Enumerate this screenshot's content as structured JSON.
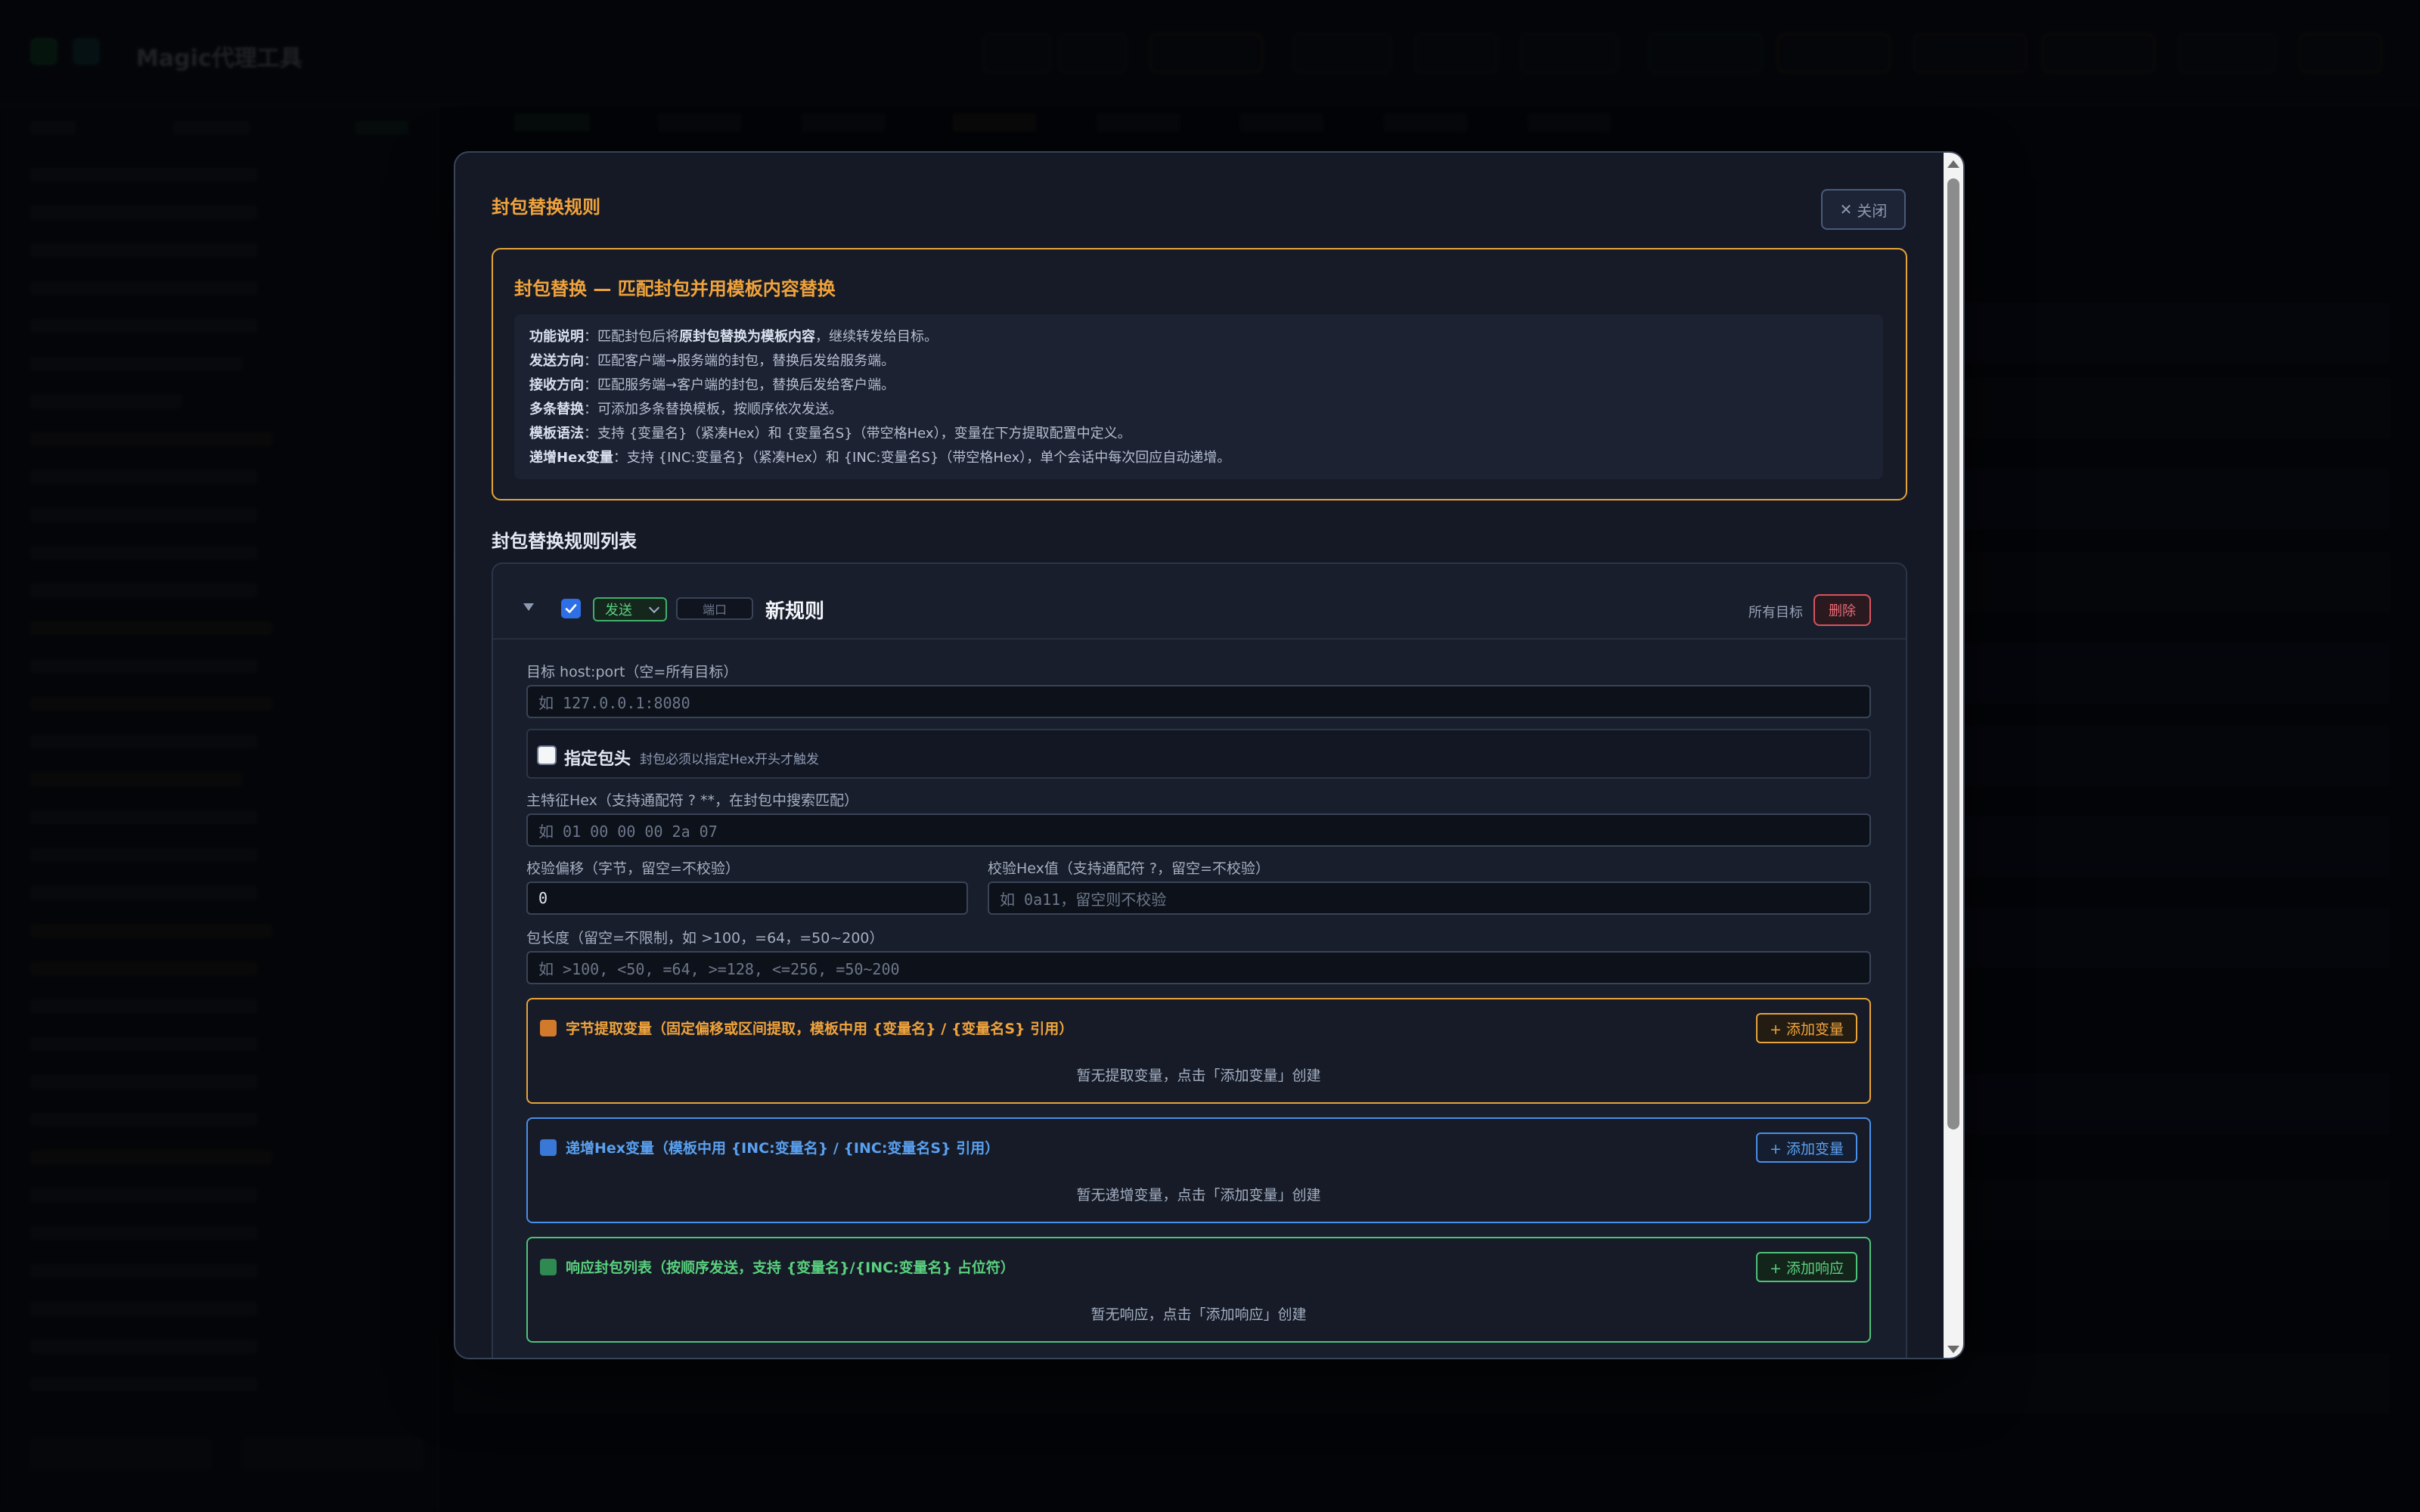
{
  "background_app": {
    "title": "Magic代理工具"
  },
  "modal": {
    "title": "封包替换规则",
    "close_label": "关闭",
    "info": {
      "heading": "封包替换 — 匹配封包并用模板内容替换",
      "lines": [
        {
          "key": "功能说明",
          "text": "：匹配封包后将",
          "bold": "原封包替换为模板内容",
          "tail": "，继续转发给目标。"
        },
        {
          "key": "发送方向",
          "text": "：匹配客户端→服务端的封包，替换后发给服务端。"
        },
        {
          "key": "接收方向",
          "text": "：匹配服务端→客户端的封包，替换后发给客户端。"
        },
        {
          "key": "多条替换",
          "text": "：可添加多条替换模板，按顺序依次发送。"
        },
        {
          "key": "模板语法",
          "text": "：支持 {变量名}（紧凑Hex）和 {变量名S}（带空格Hex），变量在下方提取配置中定义。"
        },
        {
          "key": "递增Hex变量",
          "text": "：支持 {INC:变量名}（紧凑Hex）和 {INC:变量名S}（带空格Hex），单个会话中每次回应自动递增。"
        }
      ]
    },
    "list_heading": "封包替换规则列表",
    "rule": {
      "enabled": true,
      "direction": "发送",
      "port_placeholder": "端口",
      "name": "新规则",
      "target_scope": "所有目标",
      "delete_label": "删除",
      "target_label": "目标 host:port（空=所有目标）",
      "target_placeholder": "如 127.0.0.1:8080",
      "header_checkbox_label": "指定包头",
      "header_hint": "封包必须以指定Hex开头才触发",
      "header_checked": false,
      "main_hex_label": "主特征Hex（支持通配符 ? **，在封包中搜索匹配）",
      "main_hex_placeholder": "如 01 00 00 00 2a 07",
      "check_offset_label": "校验偏移（字节，留空=不校验）",
      "check_offset_value": "0",
      "check_hex_label": "校验Hex值（支持通配符 ?，留空=不校验）",
      "check_hex_placeholder": "如 0a11，留空则不校验",
      "length_label": "包长度（留空=不限制，如 >100，=64，=50~200）",
      "length_placeholder": "如 >100, <50, =64, >=128, <=256, =50~200",
      "extract": {
        "title": "字节提取变量（固定偏移或区间提取，模板中用 {变量名} / {变量名S} 引用）",
        "button": "+ 添加变量",
        "empty": "暂无提取变量，点击「添加变量」创建",
        "icon": "inbox-tray-icon",
        "color": "#e8a33a"
      },
      "increment": {
        "title": "递增Hex变量（模板中用 {INC:变量名} / {INC:变量名S} 引用）",
        "button": "+ 添加变量",
        "empty": "暂无递增变量，点击「添加变量」创建",
        "icon": "numbers-icon",
        "color": "#4a8fe8"
      },
      "response": {
        "title": "响应封包列表（按顺序发送，支持 {变量名}/{INC:变量名} 占位符）",
        "button": "+ 添加响应",
        "empty": "暂无响应，点击「添加响应」创建",
        "icon": "outbox-tray-icon",
        "color": "#4ec27a"
      }
    }
  }
}
